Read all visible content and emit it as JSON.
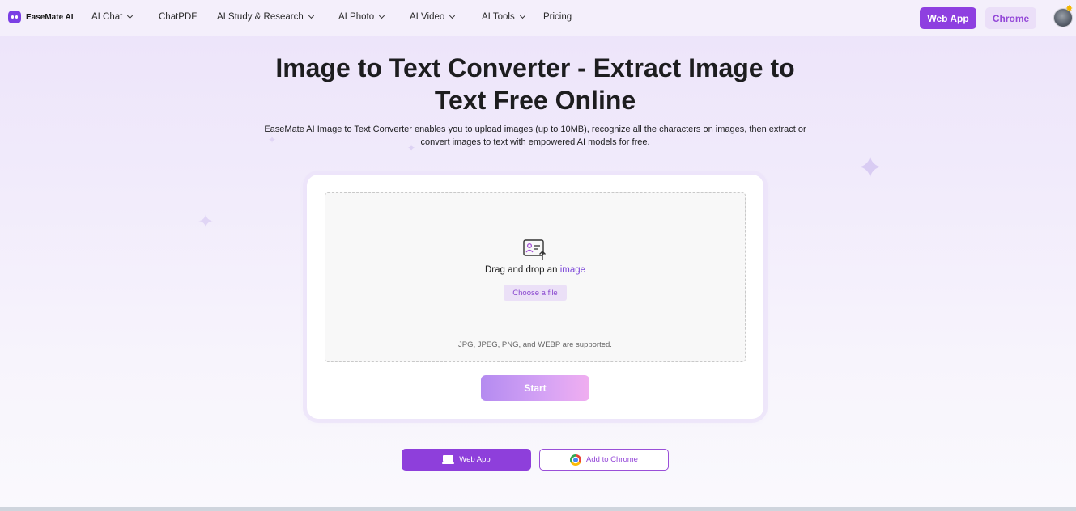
{
  "header": {
    "logo_text": "EaseMate AI",
    "nav": [
      {
        "label": "AI Chat",
        "dropdown": true
      },
      {
        "label": "ChatPDF",
        "dropdown": false
      },
      {
        "label": "AI Study & Research",
        "dropdown": true
      },
      {
        "label": "AI Photo",
        "dropdown": true
      },
      {
        "label": "AI Video",
        "dropdown": true
      },
      {
        "label": "AI Tools",
        "dropdown": true
      },
      {
        "label": "Pricing",
        "dropdown": false
      }
    ],
    "web_app_label": "Web App",
    "chrome_label": "Chrome"
  },
  "hero": {
    "title_line1": "Image to Text Converter - Extract Image to",
    "title_line2": "Text Free Online",
    "subtitle_line1": "EaseMate AI Image to Text Converter enables you to upload images (up to 10MB), recognize all the characters on images, then extract or",
    "subtitle_line2": "convert images to text with empowered AI models for free."
  },
  "upload": {
    "drag_text": "Drag and drop an",
    "drag_link": "image",
    "choose_label": "Choose a file",
    "formats_text": "JPG, JPEG, PNG, and WEBP are supported.",
    "start_label": "Start"
  },
  "footer_buttons": {
    "web_app_label": "Web App",
    "chrome_label": "Add to Chrome"
  },
  "colors": {
    "brand": "#8e3fe0",
    "chrome_button_bg": "#ebdff8",
    "link": "#7a45d8"
  },
  "icons": {
    "logo": "robot-face-icon",
    "upload": "image-upload-icon",
    "web_app": "laptop-icon",
    "chrome": "chrome-icon",
    "dropdown": "chevron-down-icon"
  }
}
